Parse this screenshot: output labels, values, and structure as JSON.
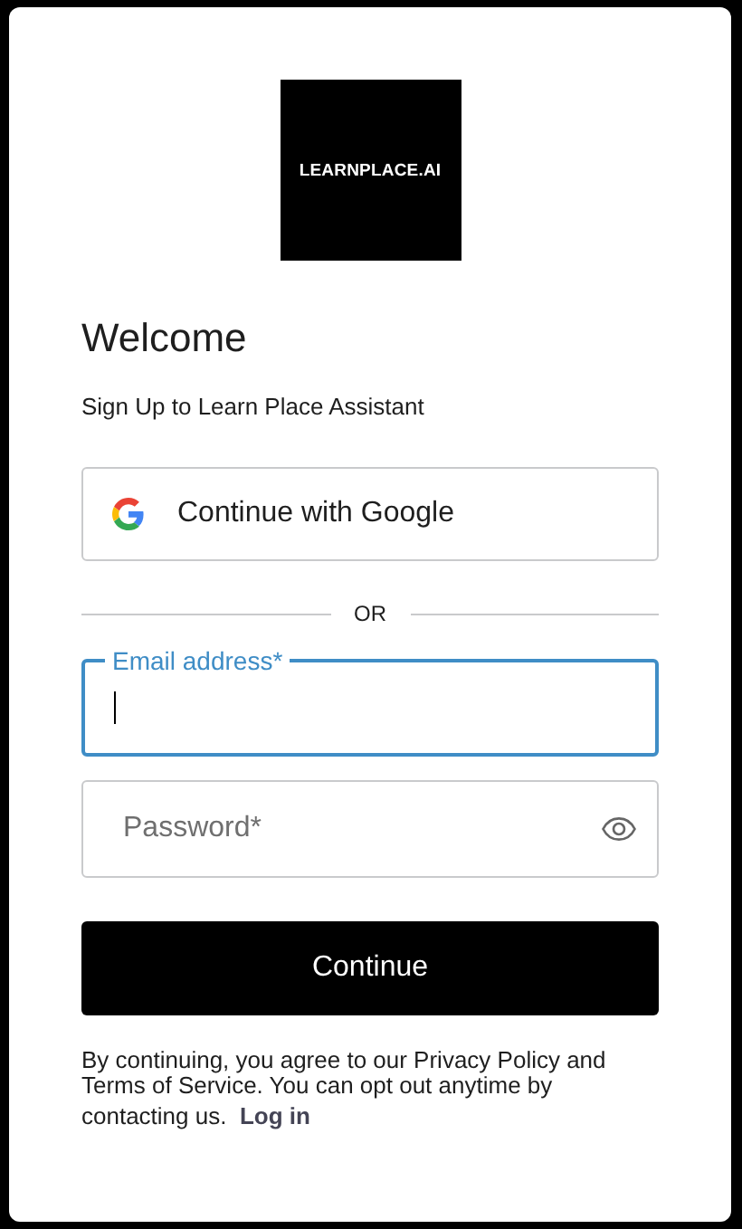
{
  "logo": {
    "text": "LEARNPLACE.AI"
  },
  "heading": "Welcome",
  "subtitle": "Sign Up to Learn Place Assistant",
  "social_button": {
    "label": "Continue with Google"
  },
  "divider": "OR",
  "fields": [
    {
      "kind": "email",
      "label": "Email address*",
      "focused": true
    },
    {
      "kind": "password",
      "placeholder": "Password*",
      "focused": false
    }
  ],
  "submit": "Continue",
  "footer": {
    "text": "By continuing, you agree to our Privacy Policy and Terms of Service. You can opt out anytime by contacting us.",
    "link": "Log in"
  }
}
